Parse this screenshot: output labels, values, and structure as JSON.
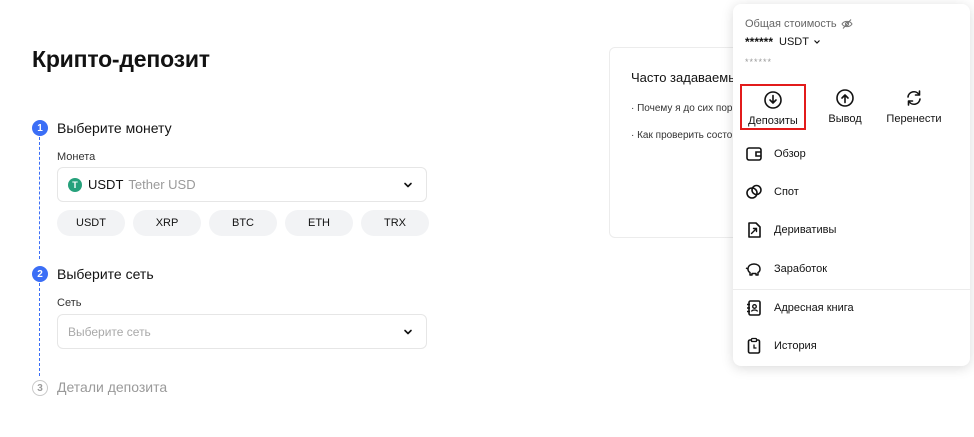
{
  "page": {
    "title": "Крипто-депозит"
  },
  "steps": [
    {
      "number": "1",
      "title": "Выберите монету"
    },
    {
      "number": "2",
      "title": "Выберите сеть"
    },
    {
      "number": "3",
      "title": "Детали депозита"
    }
  ],
  "coin": {
    "label": "Монета",
    "selected_code": "USDT",
    "selected_name": "Tether USD",
    "icon_letter": "T",
    "icon_color": "#26a17b",
    "quick_picks": [
      "USDT",
      "XRP",
      "BTC",
      "ETH",
      "TRX"
    ]
  },
  "network": {
    "label": "Сеть",
    "placeholder": "Выберите сеть"
  },
  "faq": {
    "title": "Часто задаваемые",
    "items": [
      "· Почему я до сих пор",
      "· Как проверить состо"
    ]
  },
  "wallet_menu": {
    "total_label": "Общая стоимость",
    "total_value": "******",
    "currency": "USDT",
    "sub_value": "******",
    "actions": [
      {
        "label": "Депозиты",
        "icon": "arrow-down-circle-icon"
      },
      {
        "label": "Вывод",
        "icon": "arrow-up-circle-icon"
      },
      {
        "label": "Перенести",
        "icon": "refresh-icon"
      }
    ],
    "items": [
      {
        "label": "Обзор",
        "icon": "wallet-icon"
      },
      {
        "label": "Спот",
        "icon": "coins-icon"
      },
      {
        "label": "Деривативы",
        "icon": "derivatives-icon"
      },
      {
        "label": "Заработок",
        "icon": "piggy-bank-icon"
      },
      {
        "label": "Адресная книга",
        "icon": "address-book-icon"
      },
      {
        "label": "История",
        "icon": "history-clipboard-icon"
      }
    ]
  },
  "colors": {
    "accent": "#3b6ef6",
    "highlight": "#e21b1b"
  }
}
